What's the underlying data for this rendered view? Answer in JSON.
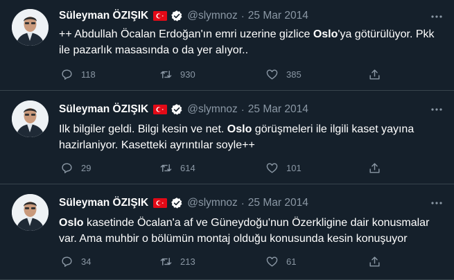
{
  "user": {
    "name": "Süleyman ÖZIŞIK",
    "handle": "@slymnoz",
    "separator": "·"
  },
  "colors": {
    "background": "#15202b",
    "secondary_text": "#8b98a5",
    "verified": "#ffffff",
    "flag_red": "#e30a17",
    "divider": "#38444d"
  },
  "icons": {
    "reply": "speech-bubble",
    "retweet": "retweet-arrows",
    "like": "heart",
    "share": "share-upload",
    "more": "three-dots"
  },
  "tweets": [
    {
      "date": "25 Mar 2014",
      "text_parts": [
        "++ Abdullah Öcalan Erdoğan'ın emri uzerine gizlice ",
        "Oslo",
        "'ya götürülüyor. Pkk ile pazarlık masasında o da yer alıyor.."
      ],
      "replies": "118",
      "retweets": "930",
      "likes": "385"
    },
    {
      "date": "25 Mar 2014",
      "text_parts": [
        "Ilk bilgiler geldi. Bilgi kesin ve net. ",
        "Oslo",
        " görüşmeleri ile ilgili kaset yayına hazirlaniyor. Kasetteki ayrıntılar soyle++"
      ],
      "replies": "29",
      "retweets": "614",
      "likes": "101"
    },
    {
      "date": "25 Mar 2014",
      "text_parts": [
        "",
        "Oslo",
        " kasetinde Öcalan'a af ve Güneydoğu'nun Özerkligine dair konusmalar var. Ama muhbir o bölümün montaj olduğu konusunda kesin konuşuyor"
      ],
      "replies": "34",
      "retweets": "213",
      "likes": "61"
    }
  ]
}
